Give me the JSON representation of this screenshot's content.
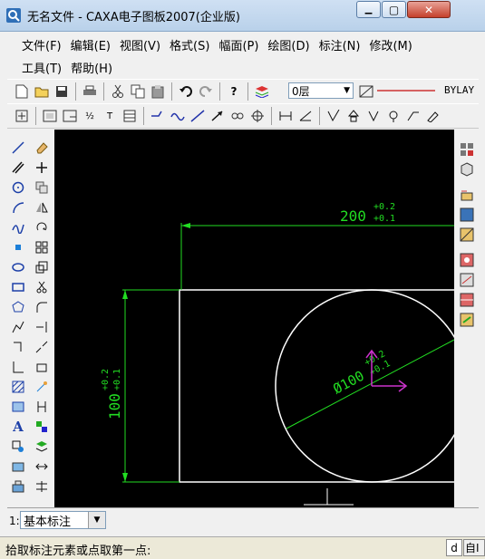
{
  "window": {
    "title": "无名文件 - CAXA电子图板2007(企业版)",
    "minimize_glyph": "▁",
    "maximize_glyph": "▢",
    "close_glyph": "✕"
  },
  "menu": {
    "row1": [
      "文件(F)",
      "编辑(E)",
      "视图(V)",
      "格式(S)",
      "幅面(P)",
      "绘图(D)",
      "标注(N)",
      "修改(M)"
    ],
    "row2": [
      "工具(T)",
      "帮助(H)"
    ]
  },
  "toolbar": {
    "layer_value": "0层",
    "linetype_value": "BYLAY"
  },
  "drawing": {
    "dim_top": "200",
    "dim_top_tol_upper": "+0.2",
    "dim_top_tol_lower": "+0.1",
    "dim_left": "100",
    "dim_left_tol_upper": "+0.2",
    "dim_left_tol_lower": "+0.1",
    "dim_circle": "Ø100",
    "dim_circle_tol_upper": "+0.2",
    "dim_circle_tol_lower": "+0.1",
    "colors": {
      "dimension": "#22dd22",
      "geometry": "#ffffff",
      "cursor": "#cc33cc",
      "background": "#000000"
    }
  },
  "command": {
    "index_label": "1:",
    "mode_value": "基本标注"
  },
  "status": {
    "prompt": "拾取标注元素或点取第一点:",
    "right_box1": "d",
    "right_box2": "自I"
  }
}
